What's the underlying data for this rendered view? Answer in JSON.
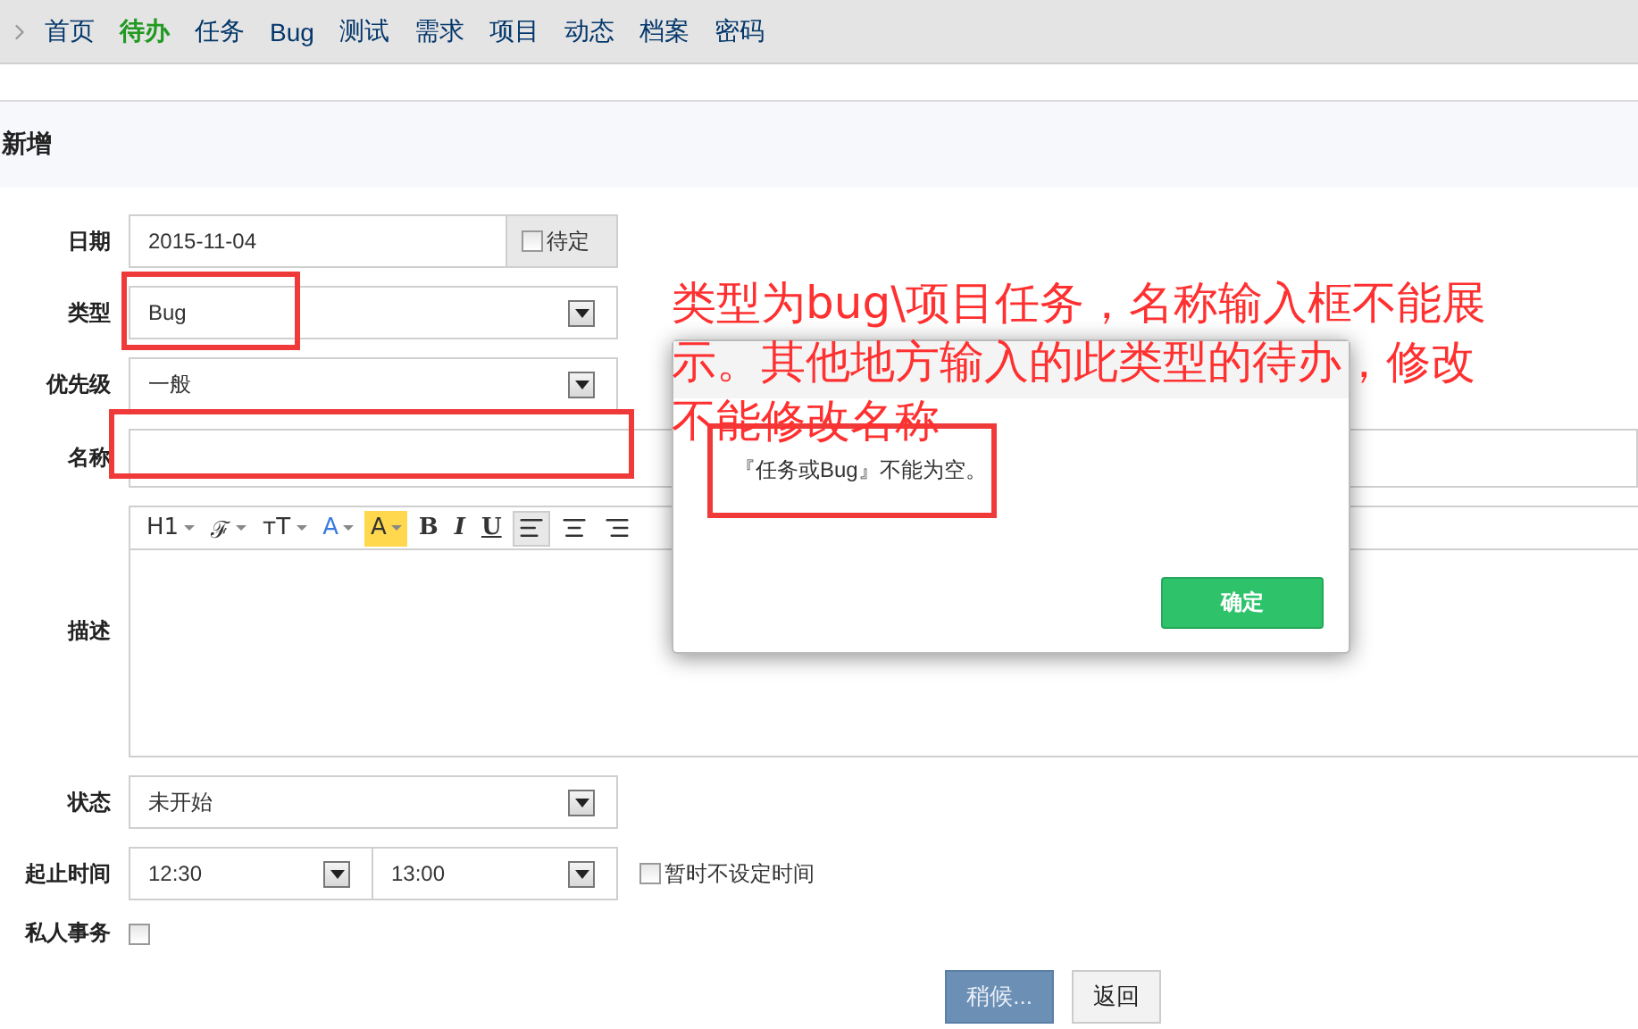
{
  "nav": {
    "items": [
      {
        "label": "首页",
        "selected": false
      },
      {
        "label": "待办",
        "selected": true
      },
      {
        "label": "任务",
        "selected": false
      },
      {
        "label": "Bug",
        "selected": false
      },
      {
        "label": "测试",
        "selected": false
      },
      {
        "label": "需求",
        "selected": false
      },
      {
        "label": "项目",
        "selected": false
      },
      {
        "label": "动态",
        "selected": false
      },
      {
        "label": "档案",
        "selected": false
      },
      {
        "label": "密码",
        "selected": false
      }
    ]
  },
  "page_title": "新增",
  "form": {
    "date": {
      "label": "日期",
      "value": "2015-11-04",
      "pending": {
        "label": "待定",
        "checked": false
      }
    },
    "type": {
      "label": "类型",
      "value": "Bug"
    },
    "priority": {
      "label": "优先级",
      "value": "一般"
    },
    "name": {
      "label": "名称"
    },
    "editor": {
      "label": "描述",
      "toolbar": [
        {
          "kind": "text",
          "label": "H1",
          "menu": true
        },
        {
          "kind": "font",
          "label": "ℱ",
          "menu": true
        },
        {
          "kind": "size",
          "label": "тT",
          "menu": true
        },
        {
          "kind": "color",
          "label": "A",
          "menu": true
        },
        {
          "kind": "highlight",
          "label": "A",
          "menu": true
        },
        {
          "kind": "bold",
          "label": "B",
          "menu": false
        },
        {
          "kind": "italic",
          "label": "I",
          "menu": false
        },
        {
          "kind": "underline",
          "label": "U",
          "menu": false
        },
        {
          "kind": "align-left",
          "selected": true
        },
        {
          "kind": "align-center",
          "selected": false
        },
        {
          "kind": "align-right",
          "selected": false
        }
      ]
    },
    "status": {
      "label": "状态",
      "value": "未开始"
    },
    "time": {
      "label": "起止时间",
      "begin": "12:30",
      "end": "13:00",
      "no_time": {
        "label": "暂时不设定时间",
        "checked": false
      }
    },
    "private": {
      "label": "私人事务",
      "checked": false
    },
    "buttons": [
      {
        "label": "稍候...",
        "kind": "primary"
      },
      {
        "label": "返回",
        "kind": "default"
      }
    ]
  },
  "dialog": {
    "message": "『任务或Bug』不能为空。",
    "ok": "确定"
  },
  "annotation": [
    "类型为bug\\项目任务，名称输入框不能展",
    "示。其他地方输入的此类型的待办，修改",
    "不能修改名称"
  ]
}
